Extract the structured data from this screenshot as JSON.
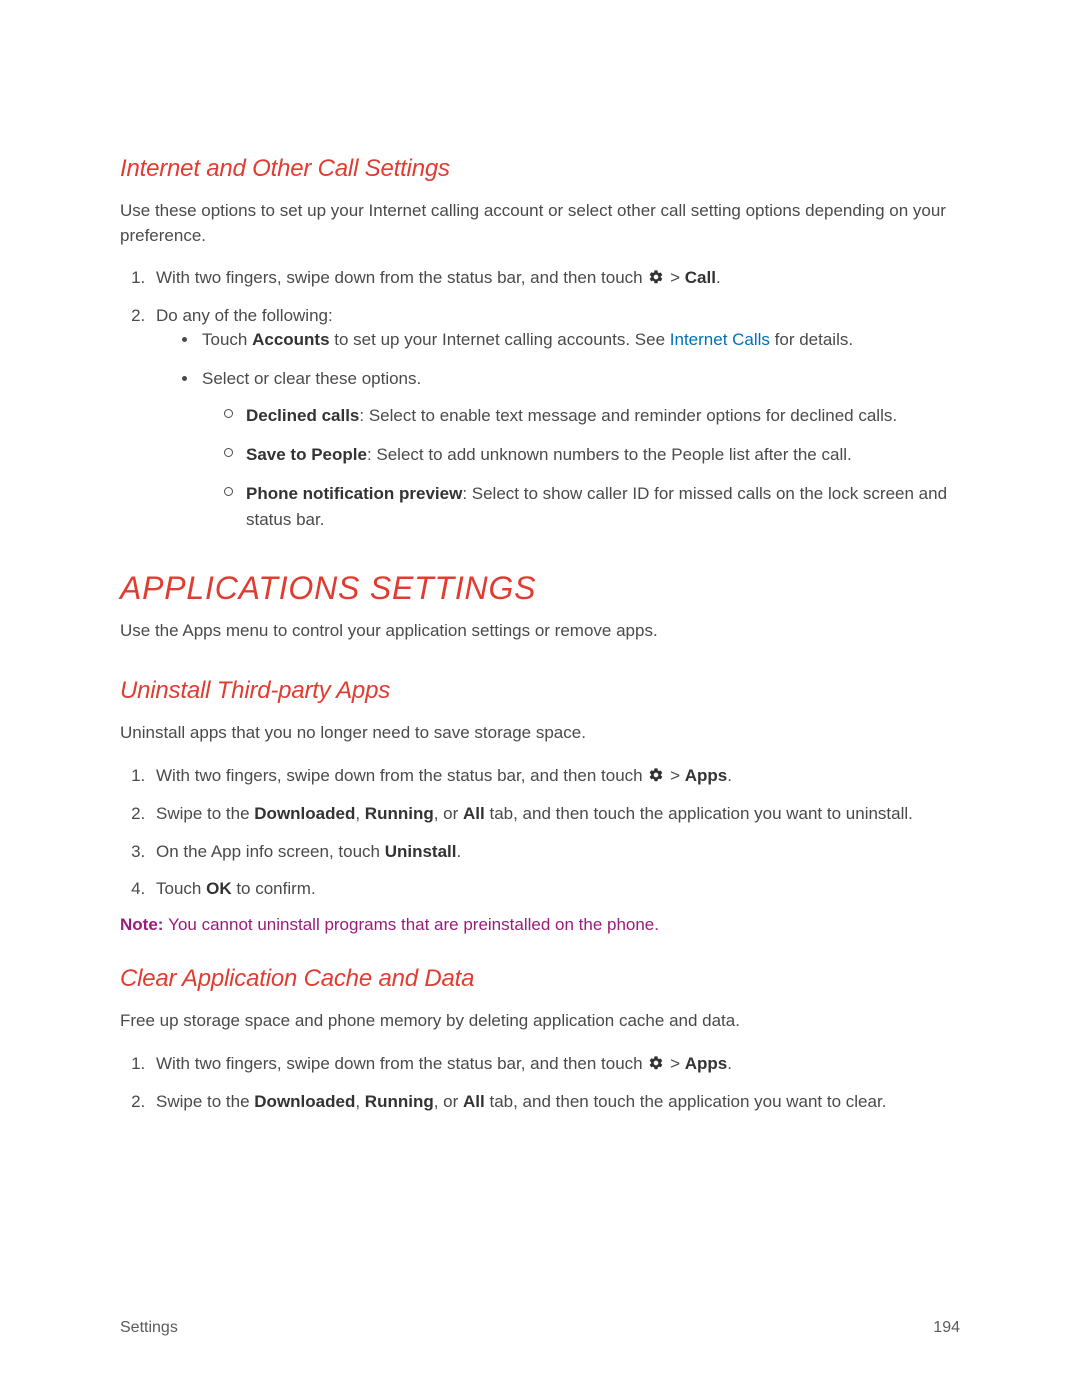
{
  "section1": {
    "heading": "Internet and Other Call Settings",
    "intro": "Use these options to set up your Internet calling account or select other call setting options depending on your preference.",
    "step1_a": "With two fingers, swipe down from the status bar, and then touch ",
    "gt1": " > ",
    "call": "Call",
    "period": ".",
    "step2": "Do any of the following:",
    "b1_a": "Touch ",
    "accounts": "Accounts",
    "b1_b": " to set up your Internet calling accounts. See ",
    "link": "Internet Calls",
    "b1_c": " for details.",
    "b2": "Select or clear these options.",
    "c1_label": "Declined calls",
    "c1_text": ": Select to enable text message and reminder options for declined calls.",
    "c2_label": "Save to People",
    "c2_text": ": Select to add unknown numbers to the People list after the call.",
    "c3_label": "Phone notification preview",
    "c3_text": ": Select to show caller ID for missed calls on the lock screen and status bar."
  },
  "major": {
    "heading": "APPLICATIONS SETTINGS",
    "intro": "Use the Apps menu to control your application settings or remove apps."
  },
  "section2": {
    "heading": "Uninstall Third-party Apps",
    "intro": "Uninstall apps that you no longer need to save storage space.",
    "step1_a": "With two fingers, swipe down from the status bar, and then touch ",
    "gt": " > ",
    "apps": "Apps",
    "period": ".",
    "step2_a": "Swipe to the ",
    "downloaded": "Downloaded",
    "comma1": ", ",
    "running": "Running",
    "comma2": ", or ",
    "all": "All",
    "step2_b": " tab, and then touch the application you want to uninstall.",
    "step3_a": "On the App info screen, touch ",
    "uninstall": "Uninstall",
    "step4_a": "Touch ",
    "ok": "OK",
    "step4_b": " to confirm.",
    "note_label": "Note:  ",
    "note_text": "You cannot uninstall programs that are preinstalled on the phone."
  },
  "section3": {
    "heading": "Clear Application Cache and Data",
    "intro": "Free up storage space and phone memory by deleting application cache and data.",
    "step1_a": "With two fingers, swipe down from the status bar, and then touch ",
    "gt": " > ",
    "apps": "Apps",
    "period": ".",
    "step2_a": "Swipe to the ",
    "downloaded": "Downloaded",
    "comma1": ", ",
    "running": "Running",
    "comma2": ", or ",
    "all": "All",
    "step2_b": " tab, and then touch the application you want to clear."
  },
  "footer": {
    "left": "Settings",
    "right": "194"
  }
}
